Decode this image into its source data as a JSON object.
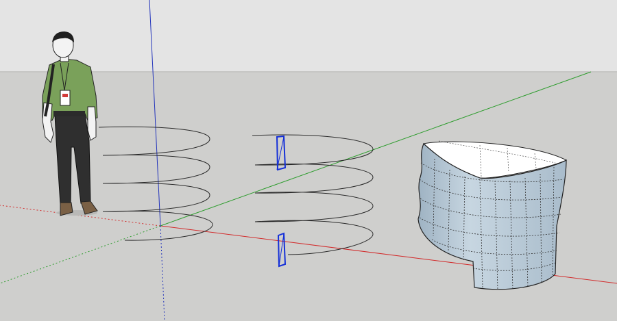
{
  "viewport": {
    "sky_color": "#e4e4e4",
    "ground_color": "#cfcfcd",
    "horizon_color": "#bdbdbb"
  },
  "axes": {
    "red_axis_color": "#d22a2a",
    "green_axis_color": "#2c9c2c",
    "blue_axis_color": "#2233bb"
  },
  "scale_figure": {
    "shirt_color": "#7aa15a",
    "pants_color": "#2f2f2f",
    "skin_color": "#f3f3f3",
    "hair_color": "#1f1f1f",
    "badge_color": "#d23a3a"
  },
  "helix_1": {
    "turns": 4,
    "line_color": "#2a2a2a"
  },
  "helix_2": {
    "turns": 4,
    "line_color": "#2a2a2a",
    "selection_color": "#1530d8"
  },
  "wall": {
    "outer_color": "#b9cbd8",
    "inner_color": "#ffffff",
    "edge_color": "#222222"
  }
}
